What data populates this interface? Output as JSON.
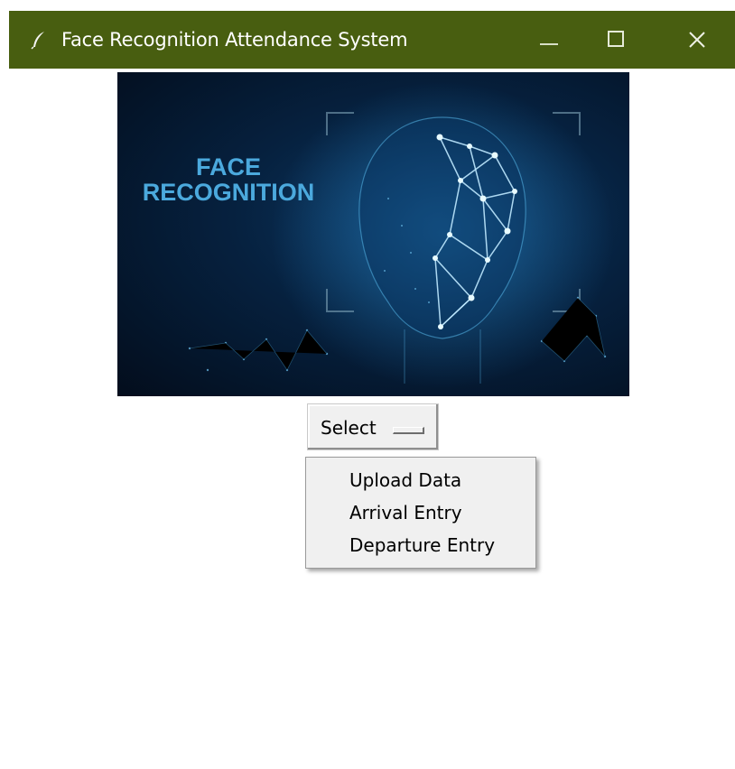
{
  "window": {
    "title": "Face Recognition Attendance System",
    "icon": "feather-icon",
    "titlebar_color": "#485e10",
    "controls": [
      "minimize-icon",
      "maximize-icon",
      "close-icon"
    ]
  },
  "banner": {
    "line1": "FACE",
    "line2": "RECOGNITION",
    "text_color": "#4ba9dd",
    "background_color": "#06213f"
  },
  "menu_button": {
    "label": "Select"
  },
  "dropdown": {
    "items": [
      {
        "label": "Upload Data"
      },
      {
        "label": "Arrival Entry"
      },
      {
        "label": "Departure Entry"
      }
    ]
  }
}
